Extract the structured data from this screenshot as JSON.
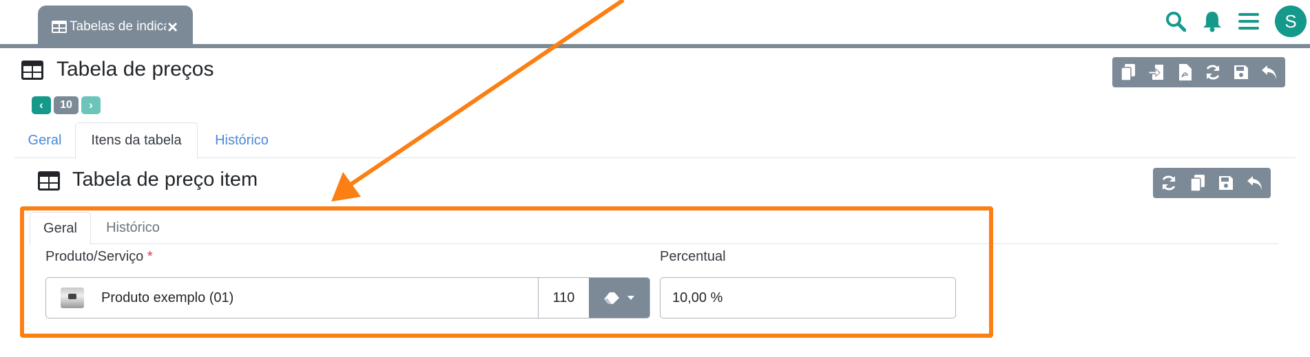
{
  "header": {
    "tab_label": "Tabelas de indicadores",
    "tab_close": "×",
    "avatar_initial": "S",
    "icons": [
      "search-icon",
      "bell-icon",
      "menu-icon"
    ],
    "accent": "#14998b"
  },
  "page": {
    "title": "Tabela de preços",
    "pager": {
      "prev": "‹",
      "number": "10",
      "next": "›"
    },
    "toolbar_icons": [
      "copy-icon",
      "import-icon",
      "pdf-icon",
      "refresh-icon",
      "save-icon",
      "undo-icon"
    ],
    "tabs": [
      {
        "label": "Geral",
        "active": false
      },
      {
        "label": "Itens da tabela",
        "active": true
      },
      {
        "label": "Histórico",
        "active": false
      }
    ]
  },
  "item": {
    "title": "Tabela de preço item",
    "toolbar_icons": [
      "refresh-icon",
      "copy-icon",
      "save-icon",
      "undo-icon"
    ],
    "tabs": [
      {
        "label": "Geral",
        "active": true
      },
      {
        "label": "Histórico",
        "active": false
      }
    ],
    "produto_label": "Produto/Serviço",
    "required_mark": "*",
    "produto_value": "Produto exemplo (01)",
    "produto_code": "110",
    "percentual_label": "Percentual",
    "percentual_value": "10,00 %"
  },
  "annotation": {
    "color": "#fb7f12"
  }
}
